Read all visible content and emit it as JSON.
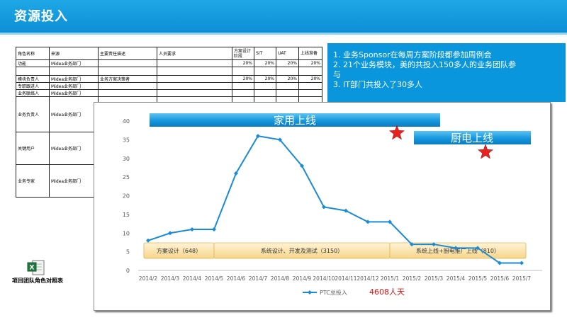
{
  "header": {
    "title": "资源投入"
  },
  "roles_table": {
    "headers": [
      "角色名称",
      "来源",
      "主要责任描述",
      "人员要求",
      "方案设计阶段",
      "SIT",
      "UAT",
      "上线准备"
    ],
    "rows": [
      [
        "功能",
        "Midea业务部门",
        "",
        "",
        "20%",
        "20%",
        "20%",
        "20%"
      ],
      [
        "",
        "",
        "",
        "",
        "",
        "",
        "",
        ""
      ],
      [
        "模块负责人",
        "Midea业务部门",
        "业务方案决策者",
        "",
        "20%",
        "20%",
        "20%",
        "20%"
      ],
      [
        "专职跟进人",
        "Midea业务部门",
        "",
        "",
        "",
        "",
        "",
        ""
      ],
      [
        "业务联络人",
        "Midea业务部门",
        "",
        "",
        "",
        "",
        "",
        ""
      ],
      [
        "业务负责人",
        "Midea业务部门",
        "",
        "",
        "",
        "",
        "",
        ""
      ],
      [
        "关键用户",
        "Midea业务部门",
        "",
        "",
        "",
        "",
        "",
        ""
      ],
      [
        "业务专家",
        "Midea业务部门",
        "",
        "",
        "",
        "",
        "",
        ""
      ]
    ]
  },
  "embedded_file": {
    "caption": "项目团队角色对照表",
    "icon": "excel-file-icon"
  },
  "notes": {
    "line1": "1. 业务Sponsor在每周方案阶段都参加周例会",
    "line2a": "2. 21个业务模块，美的共投入150多人的业务团队参",
    "line2b": "与",
    "line3": "3. IT部门共投入了30多人"
  },
  "chart_data": {
    "type": "line",
    "categories": [
      "2014/2",
      "2014/3",
      "2014/4",
      "2014/5",
      "2014/6",
      "2014/7",
      "2014/8",
      "2014/9",
      "2014/10",
      "2014/11",
      "2014/12",
      "2015/1",
      "2015/2",
      "2015/3",
      "2015/4",
      "2015/5",
      "2015/6",
      "2015/7"
    ],
    "series": [
      {
        "name": "PTC总投入",
        "values": [
          8,
          10,
          11,
          11,
          26,
          36,
          35,
          28,
          17,
          16,
          13,
          13,
          7,
          7,
          6,
          6,
          2,
          2
        ],
        "color": "#1b8bd6"
      }
    ],
    "ylim": [
      0,
      40
    ],
    "yticks": [
      0,
      5,
      10,
      15,
      20,
      25,
      30,
      35,
      40
    ],
    "grid": false,
    "legend": "bottom",
    "annotations": {
      "total": "4608人天",
      "banner1": "家用上线",
      "banner2": "厨电上线",
      "phases": [
        {
          "label": "方案设计（648）",
          "from": "2014/2",
          "to": "2014/5"
        },
        {
          "label": "系统设计、开发及测试（3150）",
          "from": "2014/5",
          "to": "2015/1"
        },
        {
          "label": "系统上线+厨电推广上线（810）",
          "from": "2015/1",
          "to": "2015/7"
        }
      ]
    }
  }
}
